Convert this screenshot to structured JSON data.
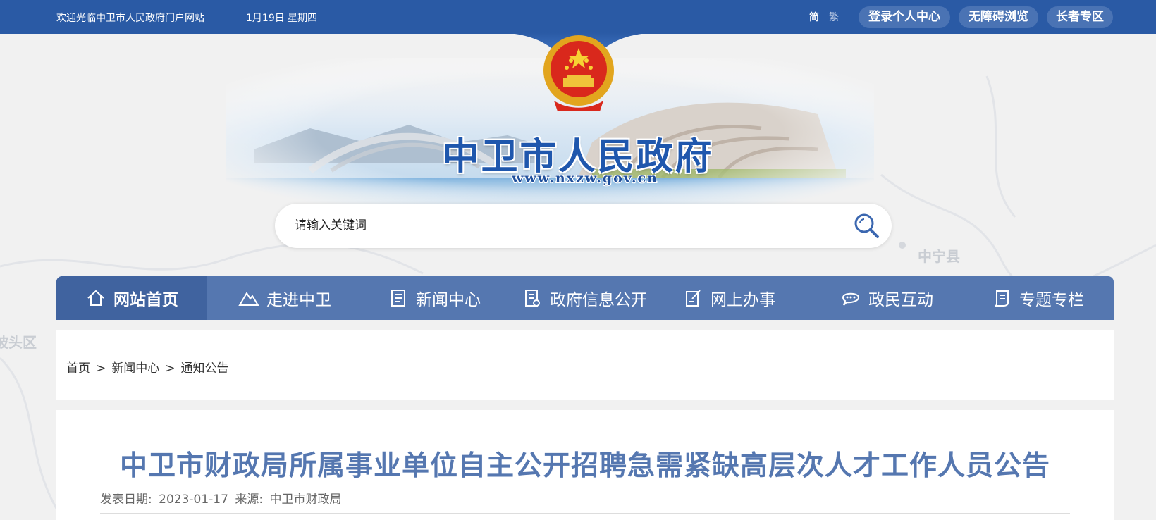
{
  "topbar": {
    "welcome": "欢迎光临中卫市人民政府门户网站",
    "date": "1月19日 星期四",
    "lang_simplified": "简",
    "lang_traditional": "繁",
    "login": "登录个人中心",
    "accessible": "无障碍浏览",
    "elderly": "长者专区"
  },
  "map_labels": {
    "left": "坡头区",
    "right": "中宁县"
  },
  "banner": {
    "title": "中卫市人民政府",
    "url": "www.nxzw.gov.cn"
  },
  "search": {
    "placeholder": "请输入关键词"
  },
  "nav": [
    {
      "label": "网站首页",
      "icon": "home-icon"
    },
    {
      "label": "走进中卫",
      "icon": "mountain-icon"
    },
    {
      "label": "新闻中心",
      "icon": "news-icon"
    },
    {
      "label": "政府信息公开",
      "icon": "document-icon"
    },
    {
      "label": "网上办事",
      "icon": "edit-icon"
    },
    {
      "label": "政民互动",
      "icon": "chat-icon"
    },
    {
      "label": "专题专栏",
      "icon": "scroll-icon"
    }
  ],
  "breadcrumb": {
    "home": "首页",
    "section": "新闻中心",
    "current": "通知公告",
    "separator": ">"
  },
  "article": {
    "title": "中卫市财政局所属事业单位自主公开招聘急需紧缺高层次人才工作人员公告",
    "date_label": "发表日期:",
    "date": "2023-01-17",
    "source_label": "来源:",
    "source": "中卫市财政局"
  },
  "colors": {
    "topbar": "#2a5aa5",
    "nav": "#5577b0",
    "nav_active": "#40639f",
    "title": "#5577b0"
  }
}
